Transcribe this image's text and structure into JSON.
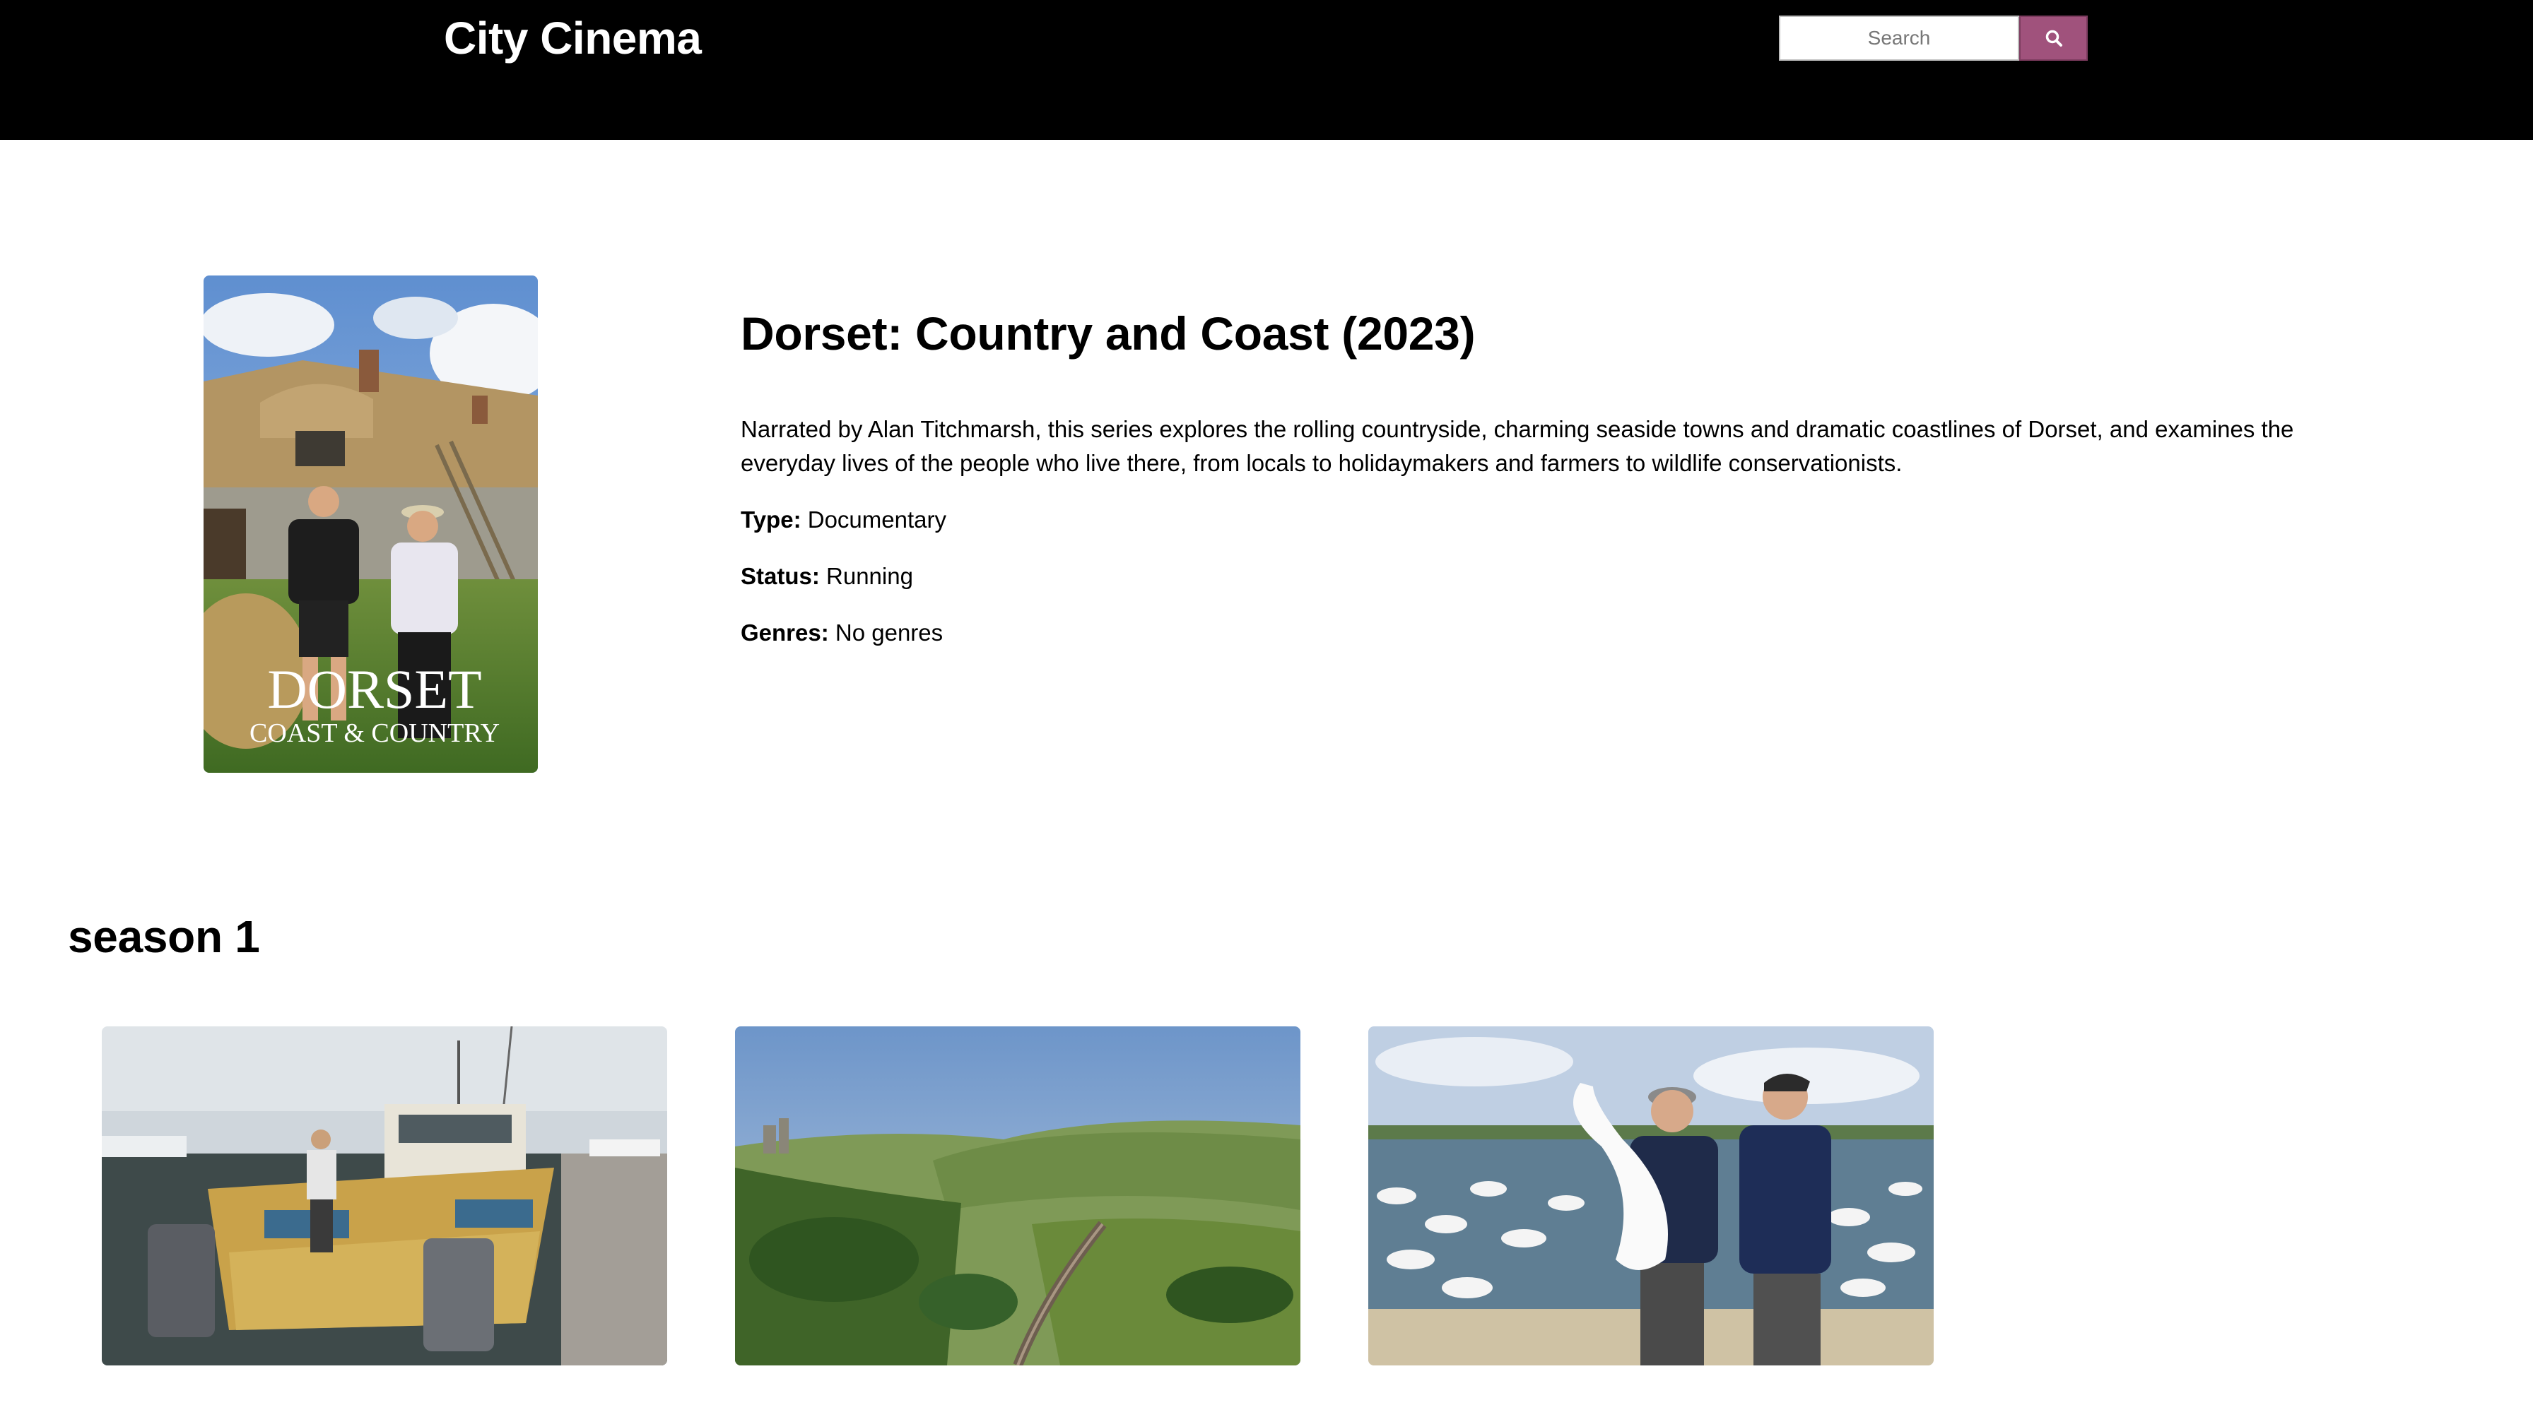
{
  "header": {
    "brand": "City Cinema",
    "search_placeholder": "Search",
    "search_icon": "search-icon"
  },
  "show": {
    "poster": {
      "title_text": "DORSET",
      "subtitle_text": "COAST & COUNTRY"
    },
    "title": "Dorset: Country and Coast (2023)",
    "summary": "Narrated by Alan Titchmarsh, this series explores the rolling countryside, charming seaside towns and dramatic coastlines of Dorset, and examines the everyday lives of the people who live there, from locals to holidaymakers and farmers to wildlife conservationists.",
    "type_label": "Type:",
    "type_value": "Documentary",
    "status_label": "Status:",
    "status_value": "Running",
    "genres_label": "Genres:",
    "genres_value": "No genres"
  },
  "season": {
    "title": "season 1",
    "episodes": [
      {
        "image": "fishing-boat-harbour"
      },
      {
        "image": "countryside-railway-castle"
      },
      {
        "image": "swan-sanctuary-presenters"
      }
    ]
  },
  "colors": {
    "header_bg": "#000000",
    "accent": "#a0527c"
  }
}
